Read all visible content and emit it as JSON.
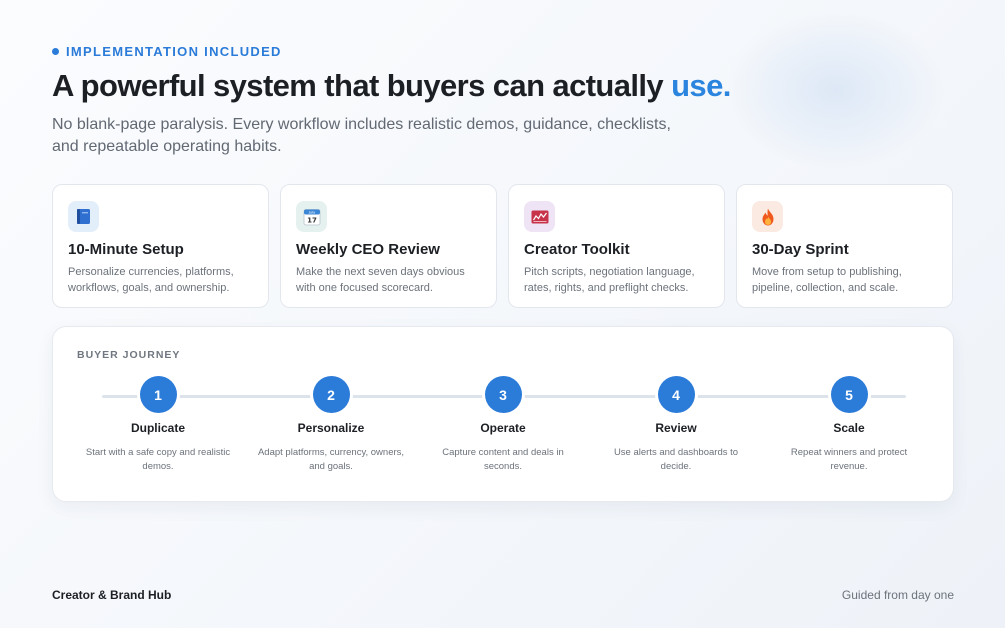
{
  "eyebrow": "IMPLEMENTATION INCLUDED",
  "headline": {
    "main": "A powerful system that buyers can actually ",
    "accent": "use."
  },
  "subtitle": "No blank-page paralysis. Every workflow includes realistic demos, guidance, checklists, and repeatable operating habits.",
  "cards": [
    {
      "icon": "book-icon",
      "icon_bg": "#e3eefb",
      "title": "10-Minute Setup",
      "desc": "Personalize currencies, platforms, workflows, goals, and ownership."
    },
    {
      "icon": "calendar-icon",
      "icon_bg": "#e4f1ee",
      "title": "Weekly CEO Review",
      "desc": "Make the next seven days obvious with one focused scorecard."
    },
    {
      "icon": "chart-icon",
      "icon_bg": "#efe4f5",
      "title": "Creator Toolkit",
      "desc": "Pitch scripts, negotiation language, rates, rights, and preflight checks."
    },
    {
      "icon": "fire-icon",
      "icon_bg": "#fbeae2",
      "title": "30-Day Sprint",
      "desc": "Move from setup to publishing, pipeline, collection, and scale."
    }
  ],
  "calendar_icon": {
    "month": "July",
    "day": "17"
  },
  "journey": {
    "label": "BUYER JOURNEY",
    "steps": [
      {
        "num": "1",
        "name": "Duplicate",
        "desc": "Start with a safe copy and realistic demos."
      },
      {
        "num": "2",
        "name": "Personalize",
        "desc": "Adapt platforms, currency, owners, and goals."
      },
      {
        "num": "3",
        "name": "Operate",
        "desc": "Capture content and deals in seconds."
      },
      {
        "num": "4",
        "name": "Review",
        "desc": "Use alerts and dashboards to decide."
      },
      {
        "num": "5",
        "name": "Scale",
        "desc": "Repeat winners and protect revenue."
      }
    ]
  },
  "footer": {
    "left": "Creator & Brand Hub",
    "right": "Guided from day one"
  },
  "colors": {
    "accent": "#2b7bd9",
    "text": "#1c1f24",
    "muted": "#6c727b"
  }
}
